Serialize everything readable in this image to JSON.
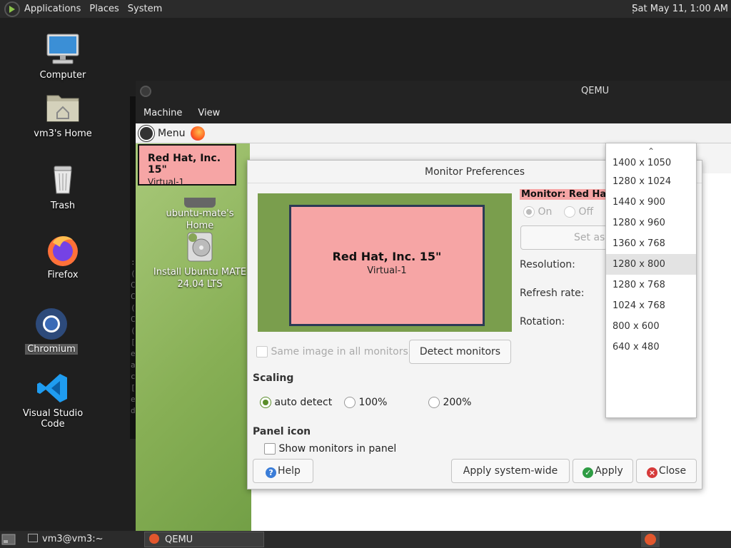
{
  "top_panel": {
    "menus": [
      "Applications",
      "Places",
      "System"
    ],
    "clock": "Sat May 11,  1:00 AM"
  },
  "desktop": {
    "icons": [
      {
        "label": "Computer"
      },
      {
        "label": "vm3's Home"
      },
      {
        "label": "Trash"
      },
      {
        "label": "Firefox"
      },
      {
        "label": "Chromium"
      },
      {
        "label": "Visual Studio Code"
      }
    ]
  },
  "qemu": {
    "title": "QEMU",
    "menus": [
      "Machine",
      "View"
    ],
    "terminal_chars": ":\n(\nC\nC\n(\nC\n(\n[\ne\na\nc\n[\ne\nd"
  },
  "guest": {
    "panel_menu": "Menu",
    "desktop_icons": [
      {
        "label": "ubuntu-mate's Home"
      },
      {
        "label": "Install Ubuntu MATE 24.04 LTS"
      }
    ]
  },
  "overlay_label": {
    "name": "Red Hat, Inc. 15\"",
    "sub": "Virtual-1"
  },
  "dialog": {
    "title": "Monitor Preferences",
    "preview": {
      "name": "Red Hat, Inc. 15\"",
      "sub": "Virtual-1"
    },
    "monitor_heading": "Monitor: Red Hat,",
    "on_label": "On",
    "off_label": "Off",
    "set_primary_label": "Set as p",
    "resolution_label": "Resolution:",
    "refresh_label": "Refresh rate:",
    "rotation_label": "Rotation:",
    "same_image_label": "Same image in all monitors",
    "detect_label": "Detect monitors",
    "scaling_heading": "Scaling",
    "scaling_options": [
      "auto detect",
      "100%",
      "200%"
    ],
    "panel_icon_heading": "Panel icon",
    "show_monitors_label": "Show monitors in panel",
    "help_label": "Help",
    "apply_system_label": "Apply system-wide",
    "apply_label": "Apply",
    "close_label": "Close"
  },
  "resolution_dropdown": {
    "up_arrow": "⌃",
    "items": [
      "1400 x 1050",
      "1280 x 1024",
      "1440 x 900",
      "1280 x 960",
      "1360 x 768",
      "1280 x 800",
      "1280 x 768",
      "1024 x 768",
      "800 x 600",
      "640 x 480"
    ],
    "selected": "1280 x 800"
  },
  "bottom_panel": {
    "tasks": [
      "vm3@vm3:~",
      "QEMU"
    ]
  },
  "colors": {
    "panel_bg": "#2b2b2b",
    "accent_green": "#5a8d2b",
    "monitor_pink": "#f6a5a5"
  }
}
